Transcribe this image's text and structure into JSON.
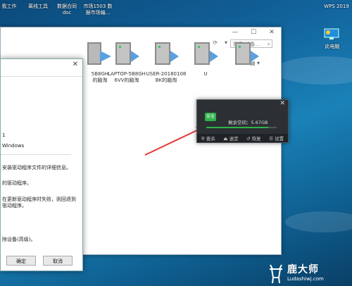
{
  "desktop": {
    "top_icons": [
      {
        "label": "我工作"
      },
      {
        "label": "离线工具"
      },
      {
        "label": "数据合同\ndoc"
      },
      {
        "label": "市场1503 数\n据市场编..."
      }
    ],
    "right_icon_label": "此电脑",
    "wps_label": "WPS 2019"
  },
  "explorer": {
    "minimize": "—",
    "maximize": "☐",
    "close": "✕",
    "search_placeholder": "搜索\"设备...",
    "drives": [
      {
        "label": "5B8GH\n的脑淘"
      },
      {
        "label": "LAPTOP-5B8GH\n6VV的脑淘"
      },
      {
        "label": "USER-20180108\nBK的脑淘"
      },
      {
        "label": "U"
      },
      {
        "label": ""
      }
    ]
  },
  "properties": {
    "close": "✕",
    "lines": [
      "1",
      "Windows",
      "安装驱动程序文件的详细信息。",
      "的驱动程序。",
      "在更新驱动程序时失败，则回退到",
      "驱动程序。",
      "除设备(高级)。"
    ],
    "ok_label": "确定",
    "cancel_label": "取消"
  },
  "security_widget": {
    "close": "✕",
    "safe_label": "安全",
    "free_space": "剩余空间：5.67GB",
    "usage_fraction": 0.88,
    "actions": [
      "查杀",
      "退定",
      "恢复",
      "设置"
    ]
  },
  "watermark": {
    "title": "鹿大师",
    "url": "Ludashiwj.com"
  },
  "colors": {
    "accent_green": "#2fb34a",
    "arrow_red": "#e03a32"
  }
}
